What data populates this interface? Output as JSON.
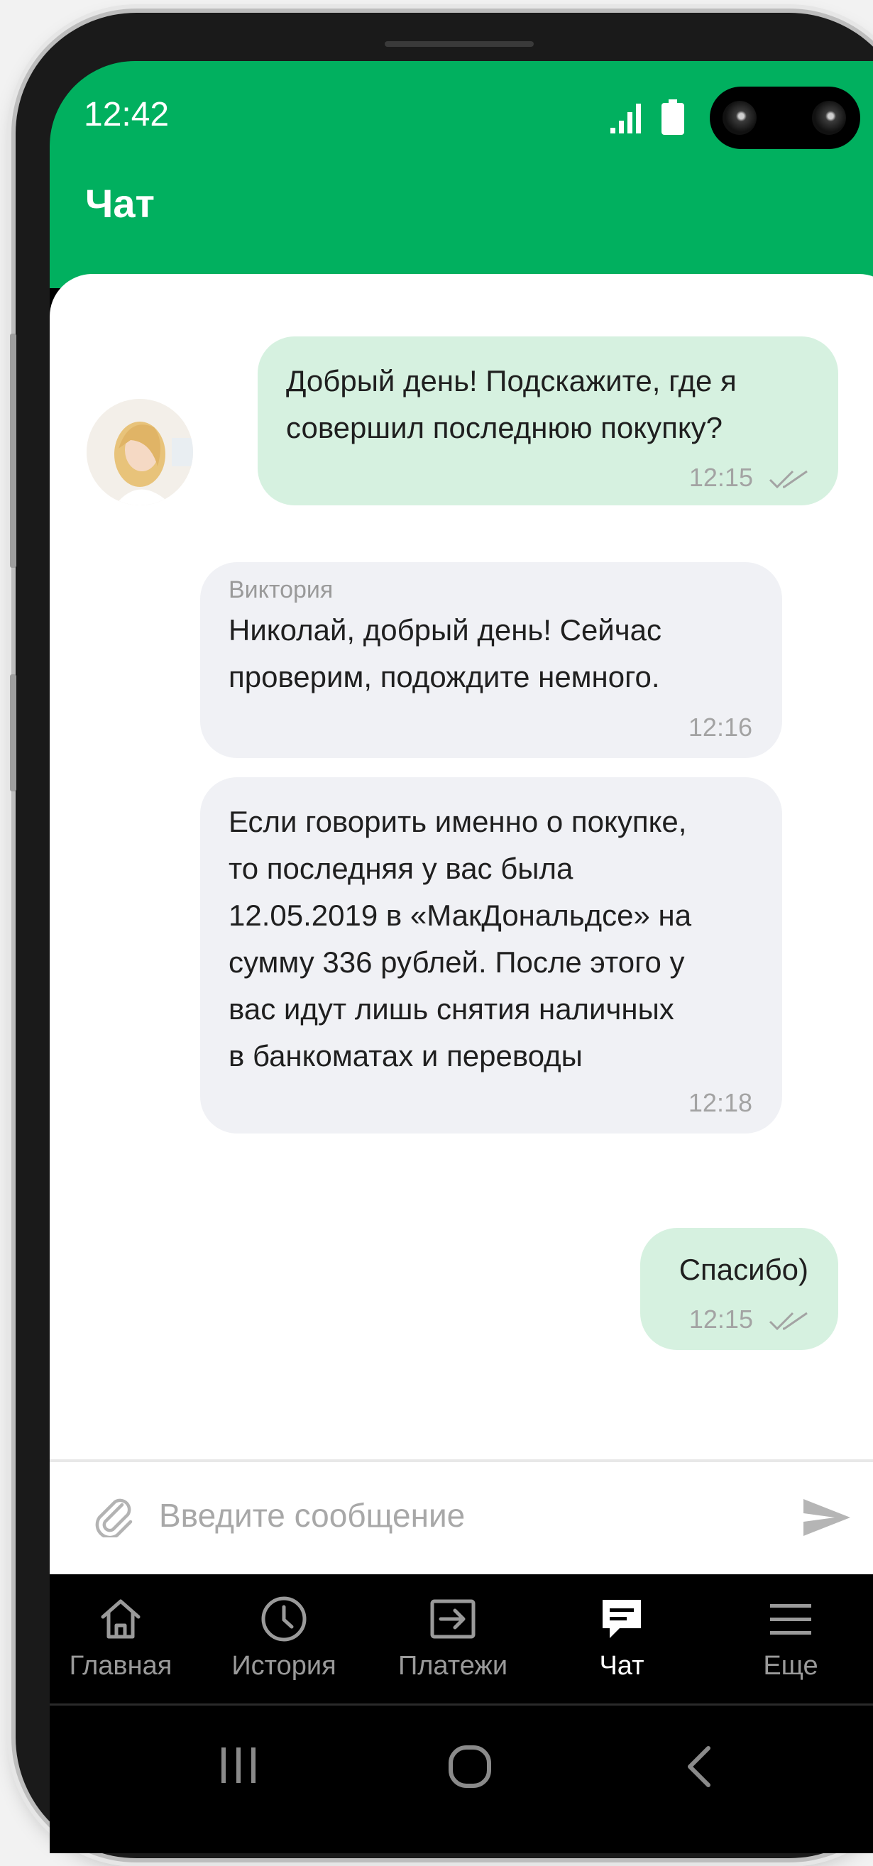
{
  "status_bar": {
    "time": "12:42"
  },
  "header": {
    "title": "Чат"
  },
  "messages": [
    {
      "direction": "out",
      "text_line1": "Добрый день! Подскажите, где я",
      "text_line2": "совершил последнюю покупку?",
      "time": "12:15"
    },
    {
      "direction": "in",
      "sender": "Виктория",
      "text_line1": "Николай, добрый день! Сейчас",
      "text_line2": "проверим, подождите немного.",
      "time": "12:16"
    },
    {
      "direction": "in",
      "lines": [
        "Если говорить именно о покупке,",
        "то последняя у вас была",
        "12.05.2019 в «МакДональдсе» на",
        "сумму 336 рублей. После этого у",
        "вас идут лишь снятия наличных",
        "в банкоматах и переводы"
      ],
      "time": "12:18"
    },
    {
      "direction": "out",
      "text": "Спасибо)",
      "time": "12:15"
    }
  ],
  "composer": {
    "placeholder": "Введите сообщение"
  },
  "tabs": [
    {
      "label": "Главная",
      "icon": "home-icon"
    },
    {
      "label": "История",
      "icon": "clock-icon"
    },
    {
      "label": "Платежи",
      "icon": "transfer-icon"
    },
    {
      "label": "Чат",
      "icon": "chat-icon",
      "active": true
    },
    {
      "label": "Еще",
      "icon": "menu-icon"
    }
  ],
  "colors": {
    "brand_green": "#01b05f",
    "outgoing_bubble": "#d6f1e0",
    "incoming_bubble": "#f0f1f5"
  }
}
